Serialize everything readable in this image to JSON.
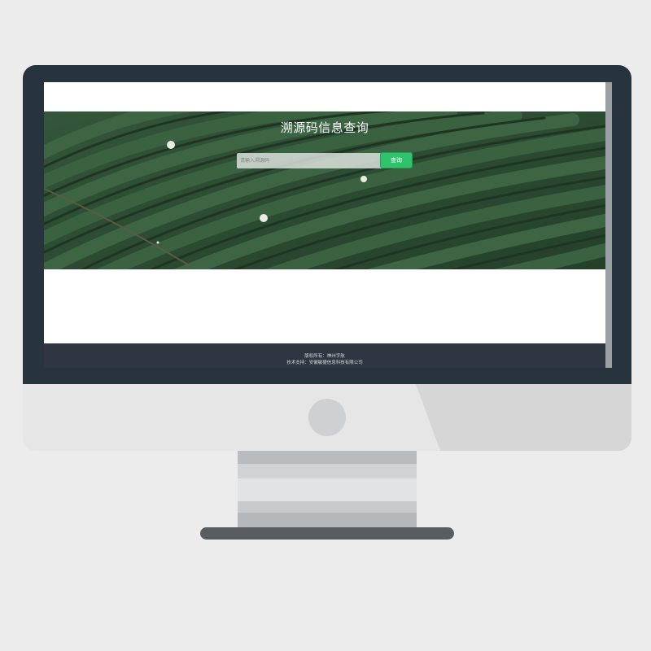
{
  "page": {
    "title": "溯源码信息查询"
  },
  "search": {
    "placeholder": "请输入溯源码",
    "button_label": "查询"
  },
  "footer": {
    "copyright": "版权所有：神州字航",
    "support": "技术支持：安徽敏捷信息科技有限公司"
  },
  "colors": {
    "button": "#2fc46b",
    "footer": "#2f3541",
    "bezel": "#27333d",
    "background": "#ececec"
  },
  "icons": {
    "power_button": "power-button-icon"
  }
}
